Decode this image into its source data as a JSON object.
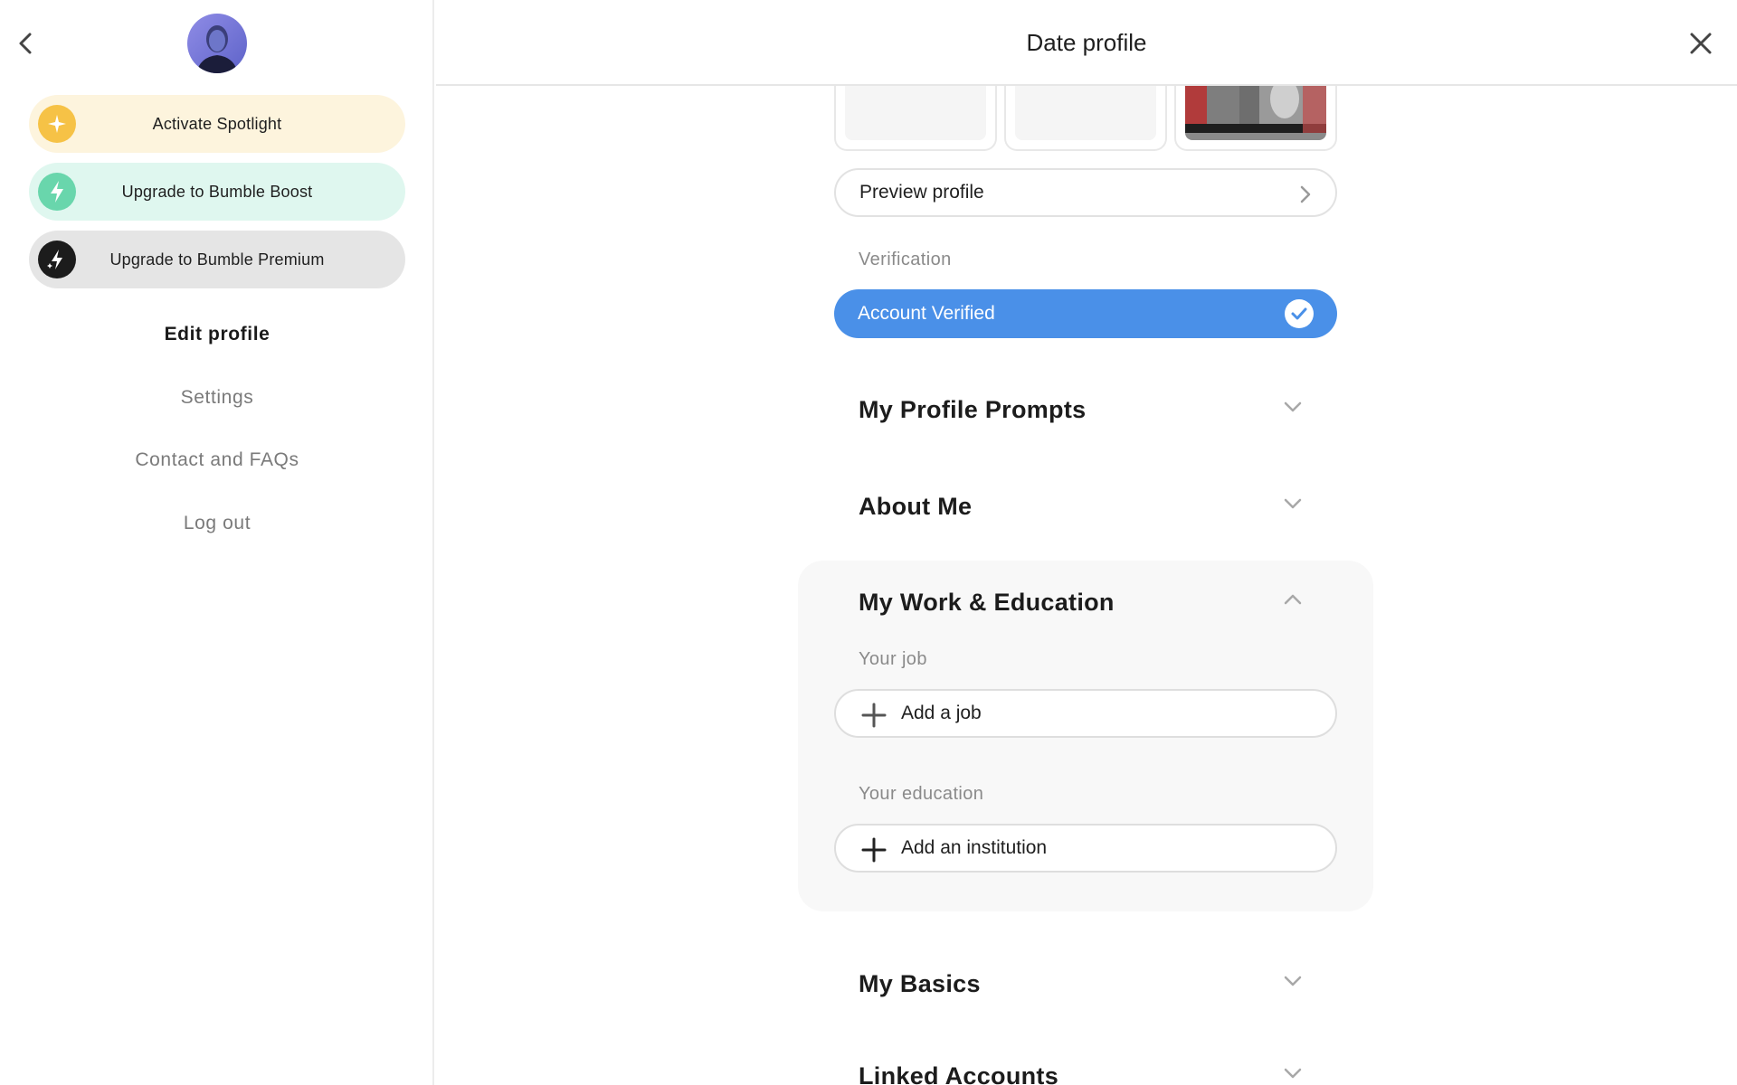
{
  "sidebar": {
    "promos": {
      "spotlight": "Activate Spotlight",
      "boost": "Upgrade to Bumble Boost",
      "premium": "Upgrade to Bumble Premium"
    },
    "nav": {
      "edit_profile": "Edit profile",
      "settings": "Settings",
      "contact": "Contact and FAQs",
      "logout": "Log out"
    }
  },
  "header": {
    "title": "Date profile"
  },
  "main": {
    "preview_profile": "Preview profile",
    "verification_label": "Verification",
    "account_verified": "Account Verified",
    "sections": {
      "prompts": "My Profile Prompts",
      "about": "About Me",
      "work": "My Work & Education",
      "basics": "My Basics",
      "linked": "Linked Accounts"
    },
    "work": {
      "job_label": "Your job",
      "add_job": "Add a job",
      "education_label": "Your education",
      "add_institution": "Add an institution"
    }
  },
  "colors": {
    "verified": "#4a90e8",
    "spotlight": "#f6c246",
    "boost": "#69d6ac",
    "premium": "#1c1c1c"
  }
}
